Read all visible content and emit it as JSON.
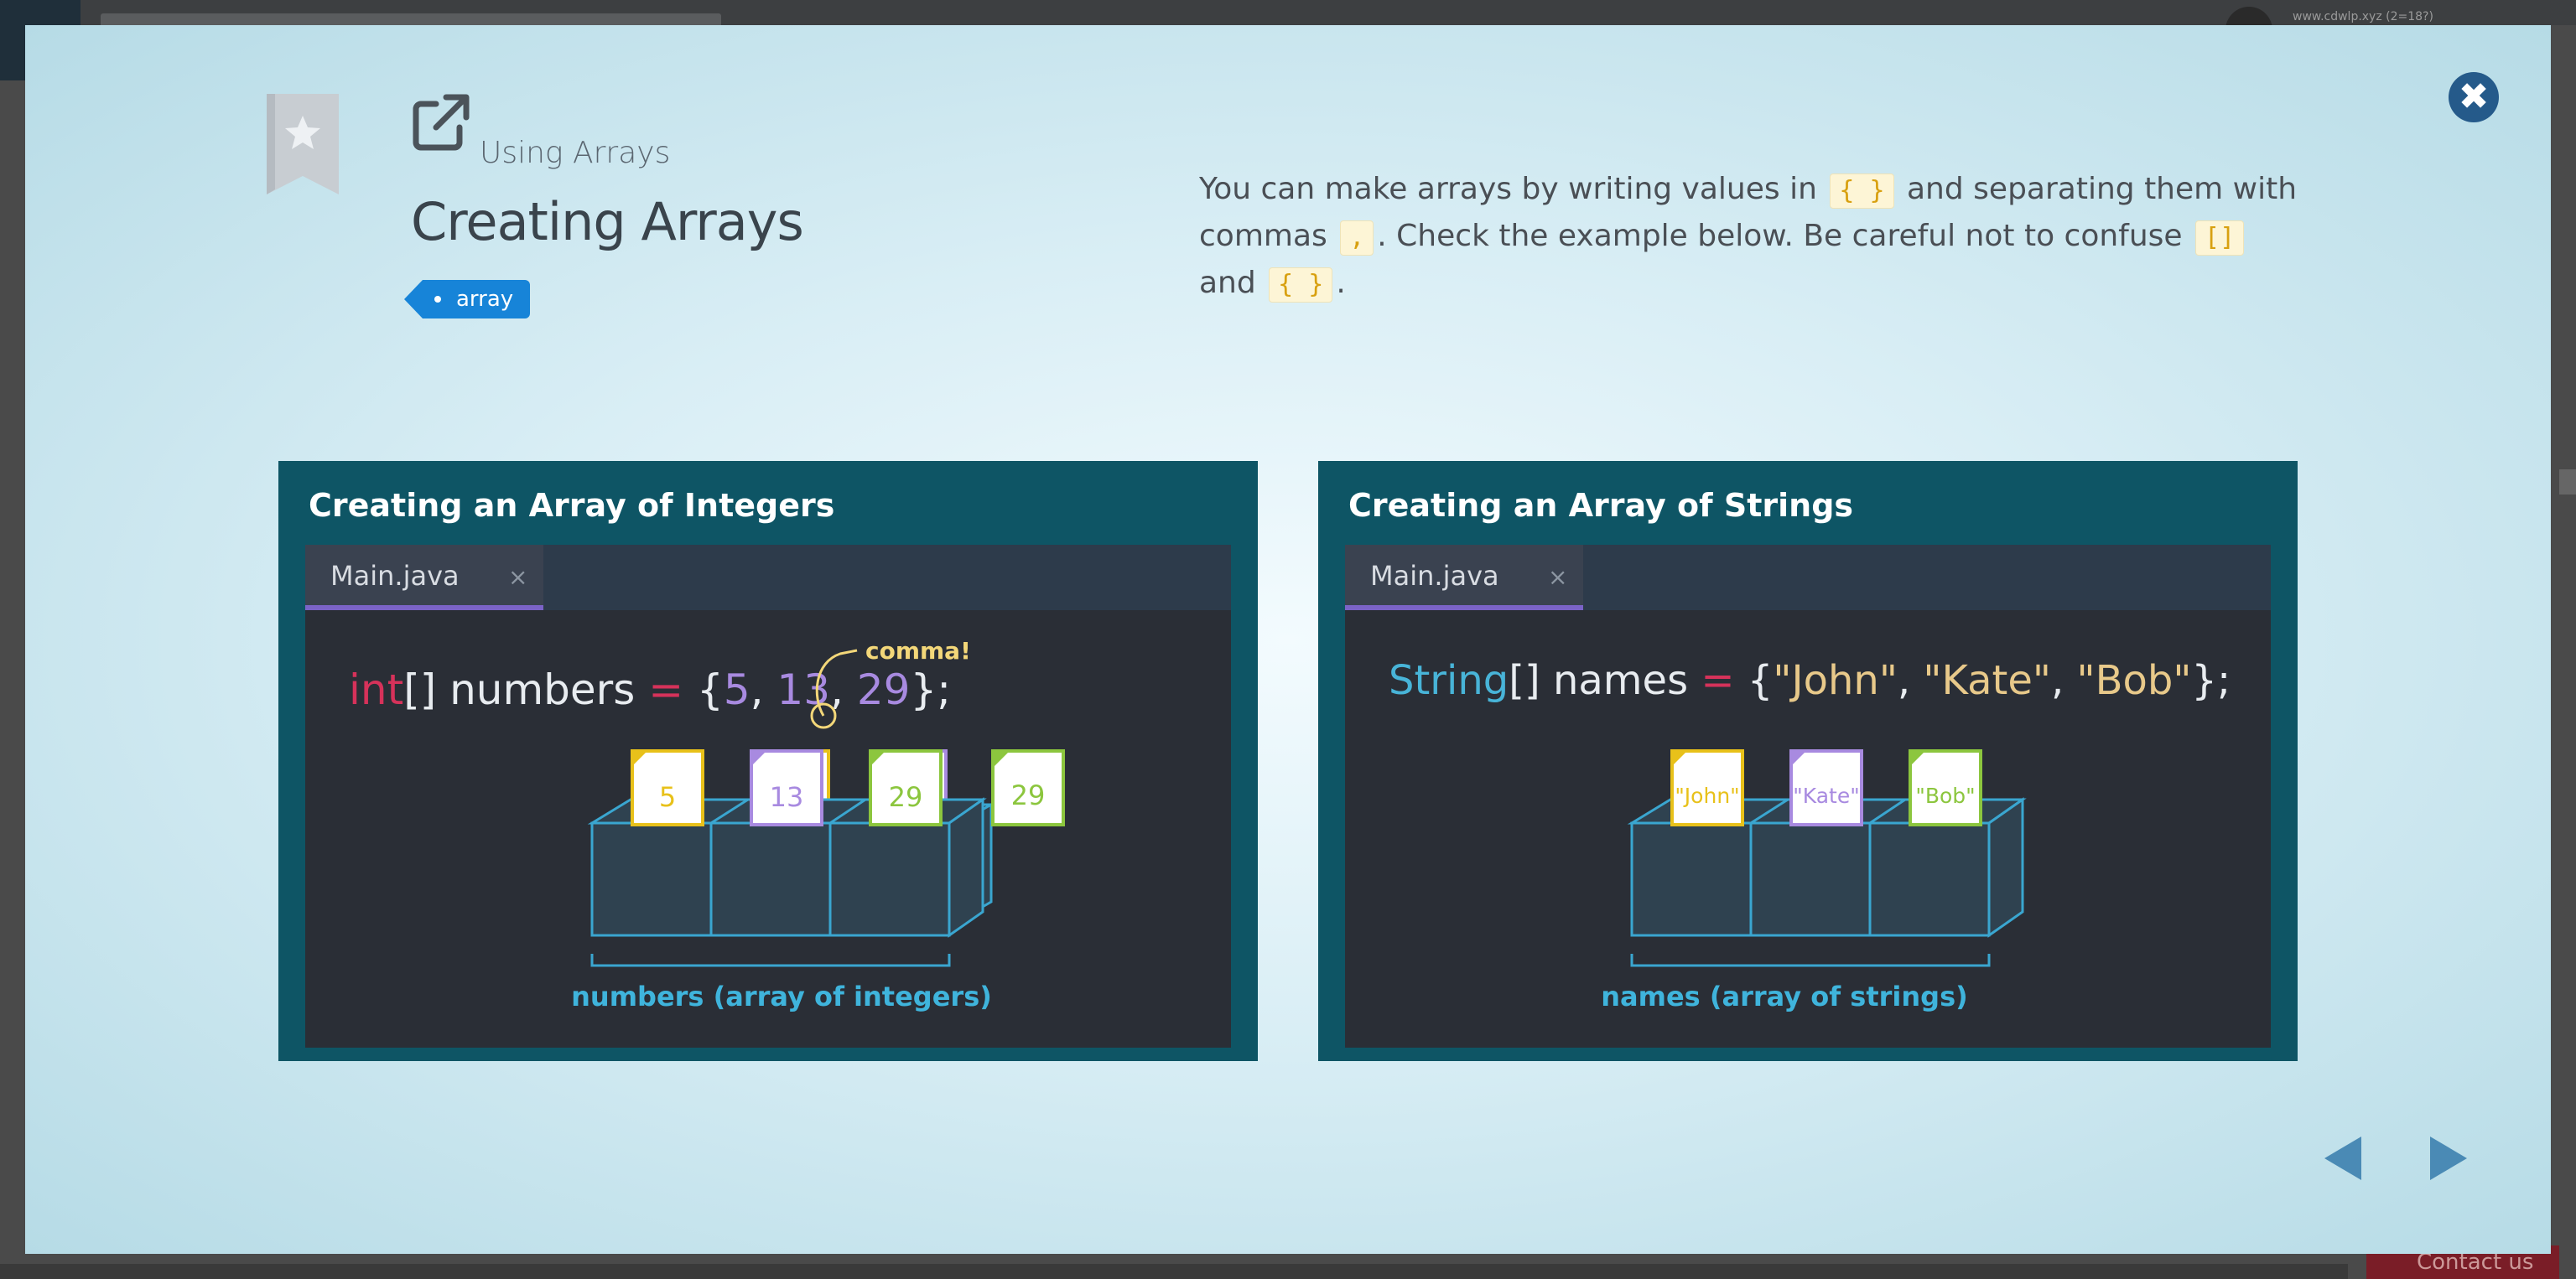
{
  "background": {
    "email": "www.cdwlp.xyz (2=18?)",
    "contact": "Contact us"
  },
  "modal": {
    "subtitle": "Using Arrays",
    "title": "Creating Arrays",
    "tag": "array",
    "close_icon": "close-icon",
    "description": {
      "p1": "You can make arrays by writing values in ",
      "chip1": "{ }",
      "p2": " and separating them with commas ",
      "chip2": ",",
      "p3": ". Check the example below. Be careful not to confuse ",
      "chip3": "[]",
      "p4": " and ",
      "chip4": "{ }",
      "p5": "."
    }
  },
  "panels": {
    "left": {
      "heading": "Creating an Array of Integers",
      "tab": "Main.java",
      "tab_close": "×",
      "code_type": "int",
      "code_rest": "[] numbers ",
      "code_eq": "=",
      "code_open": " {",
      "v1": "5",
      "sep1": ", ",
      "v2": "13",
      "sep2": ", ",
      "v3": "29",
      "code_close": "};",
      "annotation": "comma!",
      "box_values": [
        "5",
        "13",
        "29"
      ],
      "caption": "numbers (array of integers)"
    },
    "right": {
      "heading": "Creating an Array of Strings",
      "tab": "Main.java",
      "tab_close": "×",
      "code_type": "String",
      "code_rest": "[] names ",
      "code_eq": "=",
      "code_open": " {",
      "v1": "\"John\"",
      "sep1": ", ",
      "v2": "\"Kate\"",
      "sep2": ", ",
      "v3": "\"Bob\"",
      "code_close": "};",
      "box_values": [
        "\"John\"",
        "\"Kate\"",
        "\"Bob\""
      ],
      "caption": "names (array of strings)"
    }
  },
  "navigation": {
    "prev_icon": "triangle-left-icon",
    "next_icon": "triangle-right-icon"
  },
  "colors": {
    "panel_bg": "#0e5565",
    "editor_bg": "#2a2e36",
    "tab_bar": "#2d3b4b",
    "accent_purple": "#7b63c7",
    "value_yellow": "#e8c11a",
    "value_purple": "#a88ae0",
    "value_green": "#8cc63e",
    "box_blue": "#3aa6d0",
    "keyword_red": "#d6325a",
    "nav_blue": "#4a8ab5"
  }
}
